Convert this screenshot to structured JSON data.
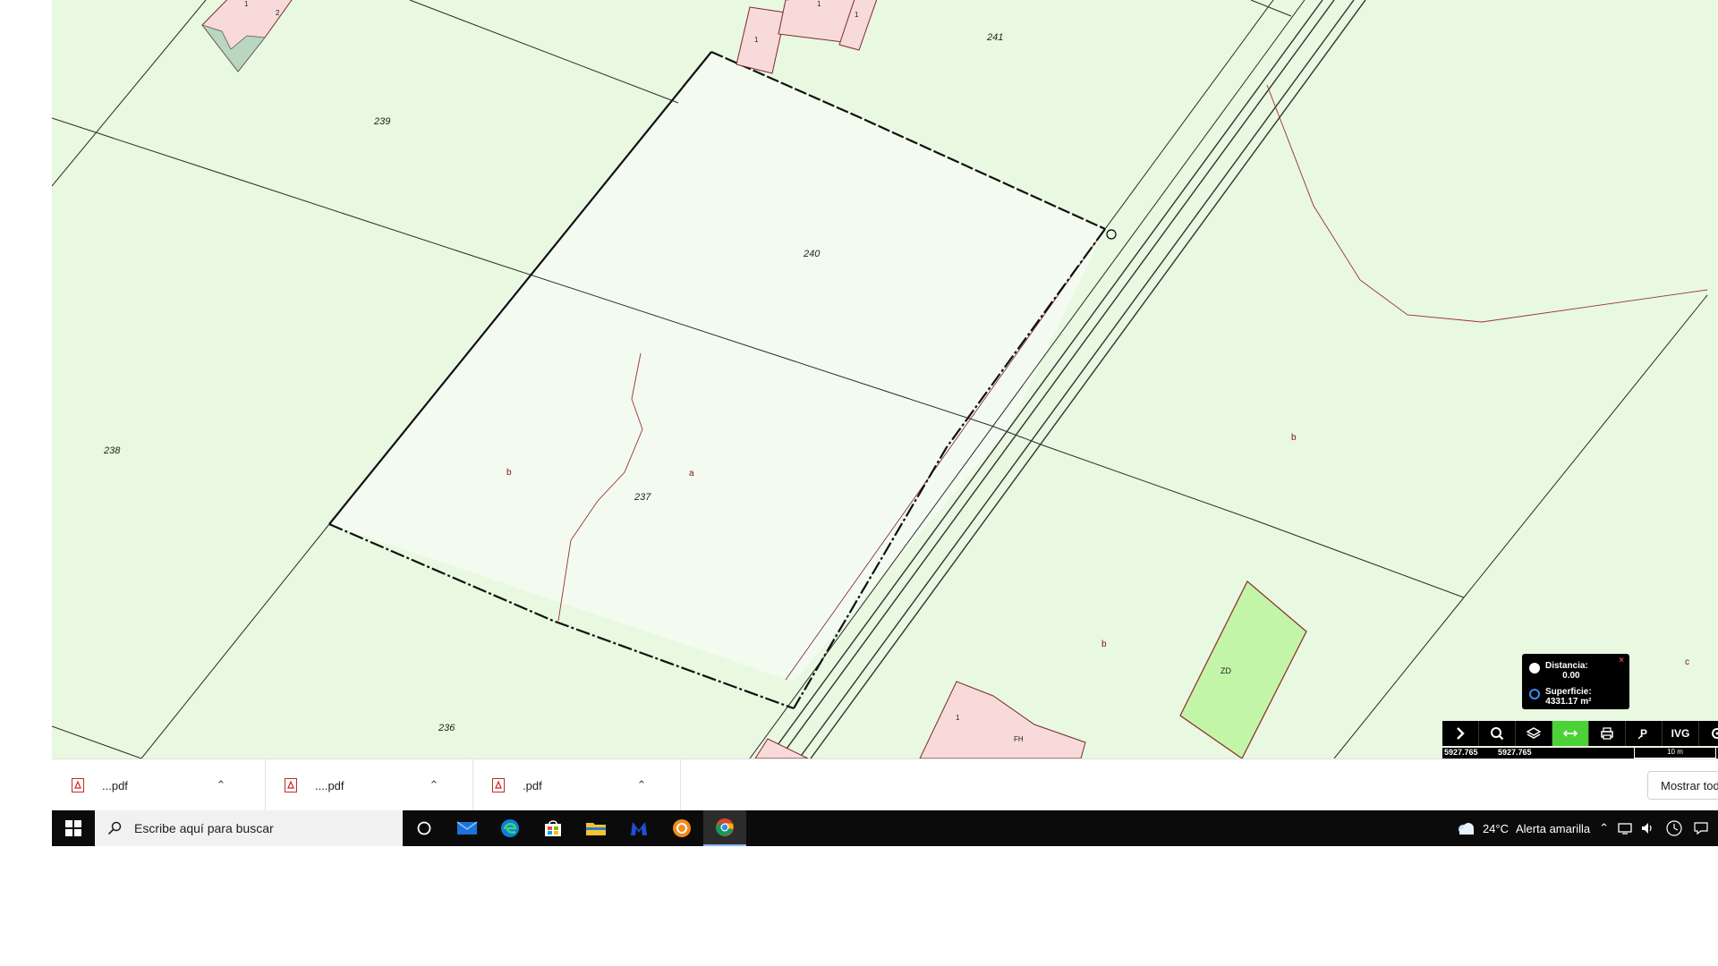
{
  "map": {
    "parcel_labels": [
      "239",
      "240",
      "241",
      "238",
      "237",
      "236"
    ],
    "subparcel_labels": [
      "b",
      "a",
      "b",
      "b",
      "c"
    ],
    "building_labels": [
      "1",
      "1",
      "1",
      "1",
      "2",
      "1",
      "ZD",
      "FH"
    ]
  },
  "measure": {
    "distance_label": "Distancia:",
    "distance_value": "0.00",
    "area_label": "Superficie:",
    "area_value": "4331.17 m²",
    "close": "×"
  },
  "toolbar": {
    "buttons": [
      {
        "icon": "chevron-right-icon"
      },
      {
        "icon": "search-icon"
      },
      {
        "icon": "layers-icon"
      },
      {
        "icon": "measure-icon",
        "active": true
      },
      {
        "icon": "print-icon"
      },
      {
        "icon": "parking-icon"
      },
      {
        "label": "IVG"
      },
      {
        "icon": "tools-icon"
      }
    ],
    "active_color": "#4cd137",
    "coord_x": "5927.765",
    "coord_y": "5927.765",
    "scale_label": "10 m"
  },
  "downloads": {
    "items": [
      {
        "name": "...pdf"
      },
      {
        "name": "....pdf"
      },
      {
        "name": ".pdf"
      }
    ],
    "show_all": "Mostrar tod"
  },
  "taskbar": {
    "search_placeholder": "Escribe aquí para buscar",
    "weather_temp": "24°C",
    "weather_alert": "Alerta amarilla",
    "accent": "#8ab4f8"
  }
}
